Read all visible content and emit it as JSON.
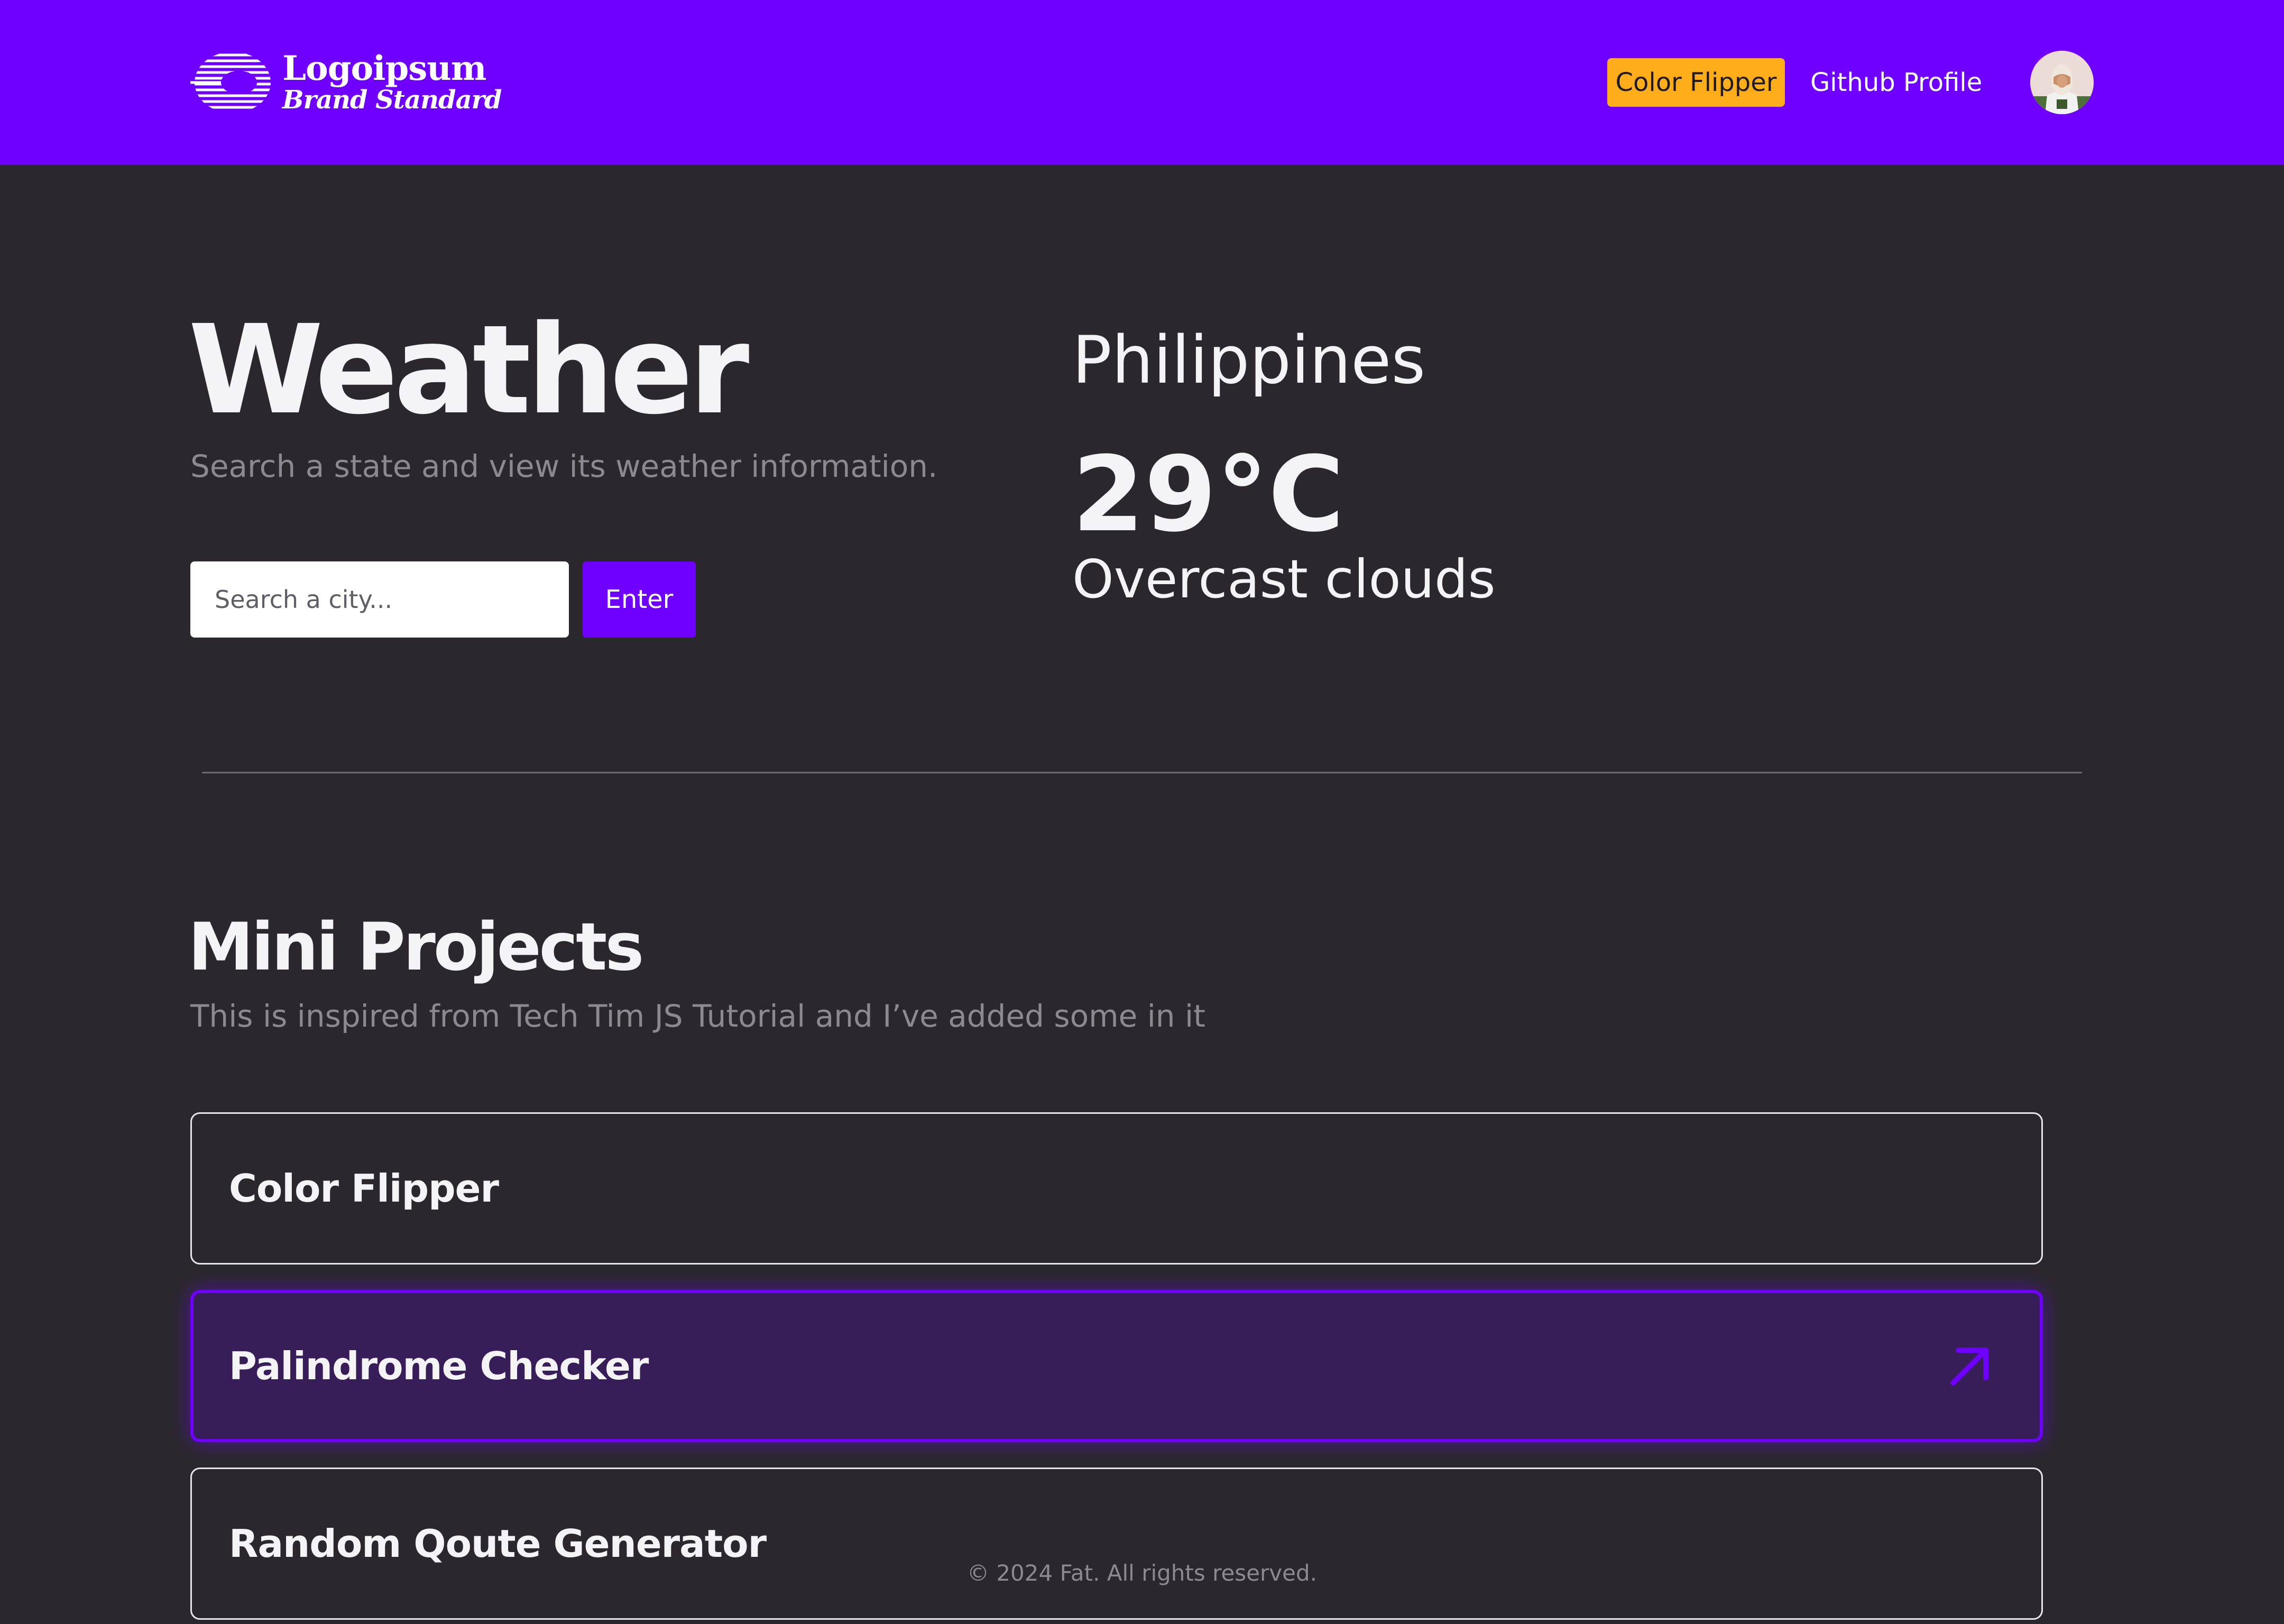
{
  "header": {
    "logo": {
      "name": "Logoipsum",
      "tagline": "Brand Standard"
    },
    "nav": {
      "color_flipper": "Color Flipper",
      "github_profile": "Github Profile"
    },
    "colors": {
      "background": "#6f00ff",
      "accent_button": "#ffad1a"
    }
  },
  "weather": {
    "title": "Weather",
    "subtitle": "Search a state and view its weather information.",
    "search": {
      "placeholder": "Search a city...",
      "value": ""
    },
    "enter_label": "Enter",
    "result": {
      "location": "Philippines",
      "temperature": "29°C",
      "condition": "Overcast clouds"
    }
  },
  "projects": {
    "title": "Mini Projects",
    "subtitle": "This is inspired from Tech Tim JS Tutorial and I’ve added some in it",
    "items": [
      {
        "label": "Color Flipper",
        "state": "default"
      },
      {
        "label": "Palindrome Checker",
        "state": "hover"
      },
      {
        "label": "Random Qoute Generator",
        "state": "default"
      }
    ]
  },
  "footer": {
    "text": "© 2024 Fat. All rights reserved."
  },
  "theme": {
    "page_bg": "#2a282c",
    "brand": "#6f00ff",
    "muted_text": "#8c8a90"
  }
}
